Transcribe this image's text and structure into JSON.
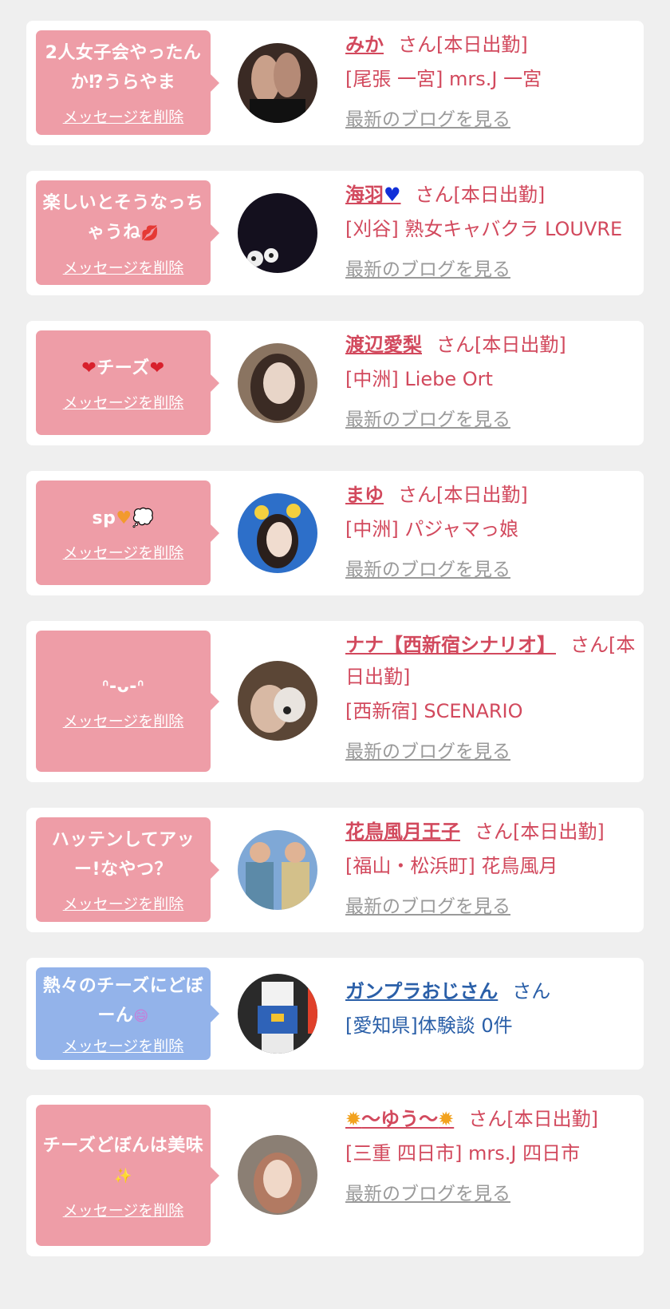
{
  "delete_label": "メッセージを削除",
  "blog_label": "最新のブログを見る",
  "items": [
    {
      "message": "2人女子会やったんか⁉うらやま",
      "name": "みか",
      "suffix": "さん[本日出勤]",
      "shop": "[尾張 一宮] mrs.J 一宮"
    },
    {
      "message": "楽しいとそうなっちゃうね",
      "name": "海羽",
      "suffix": "さん[本日出勤]",
      "shop": "[刈谷] 熟女キャバクラ LOUVRE"
    },
    {
      "message": "チーズ",
      "name": "渡辺愛梨",
      "suffix": "さん[本日出勤]",
      "shop": "[中洲] Liebe Ort"
    },
    {
      "message": "sp",
      "name": "まゆ",
      "suffix": "さん[本日出勤]",
      "shop": "[中洲] パジャマっ娘"
    },
    {
      "message": "ᐢ-ᴗ-ᐢ",
      "name": "ナナ【西新宿シナリオ】",
      "suffix": "さん[本日出勤]",
      "shop": "[西新宿] SCENARIO"
    },
    {
      "message": "ハッテンしてアッー!なやつ？",
      "name": "花鳥風月王子",
      "suffix": "さん[本日出勤]",
      "shop": "[福山・松浜町] 花鳥風月"
    },
    {
      "message": "熱々のチーズにどぼーん",
      "name": "ガンプラおじさん",
      "suffix": "さん",
      "shop": "[愛知県]体験談 0件"
    },
    {
      "message": "チーズどぼんは美味",
      "name": "〜ゆう〜",
      "suffix": "さん[本日出勤]",
      "shop": "[三重 四日市] mrs.J 四日市"
    }
  ],
  "colors": {
    "pink_bubble": "#ee9da7",
    "blue_bubble": "#93b3ea",
    "name_pink": "#d2495d",
    "name_blue": "#2a5fa8",
    "blog_gray": "#9a9a9a"
  },
  "icons": [
    "heart-blue-icon",
    "heart-red-icon",
    "heart-orange-icon",
    "thought-bubble-icon",
    "kiss-face-icon",
    "sparkle-icon",
    "sunflower-icon",
    "smile-emoji-icon"
  ]
}
